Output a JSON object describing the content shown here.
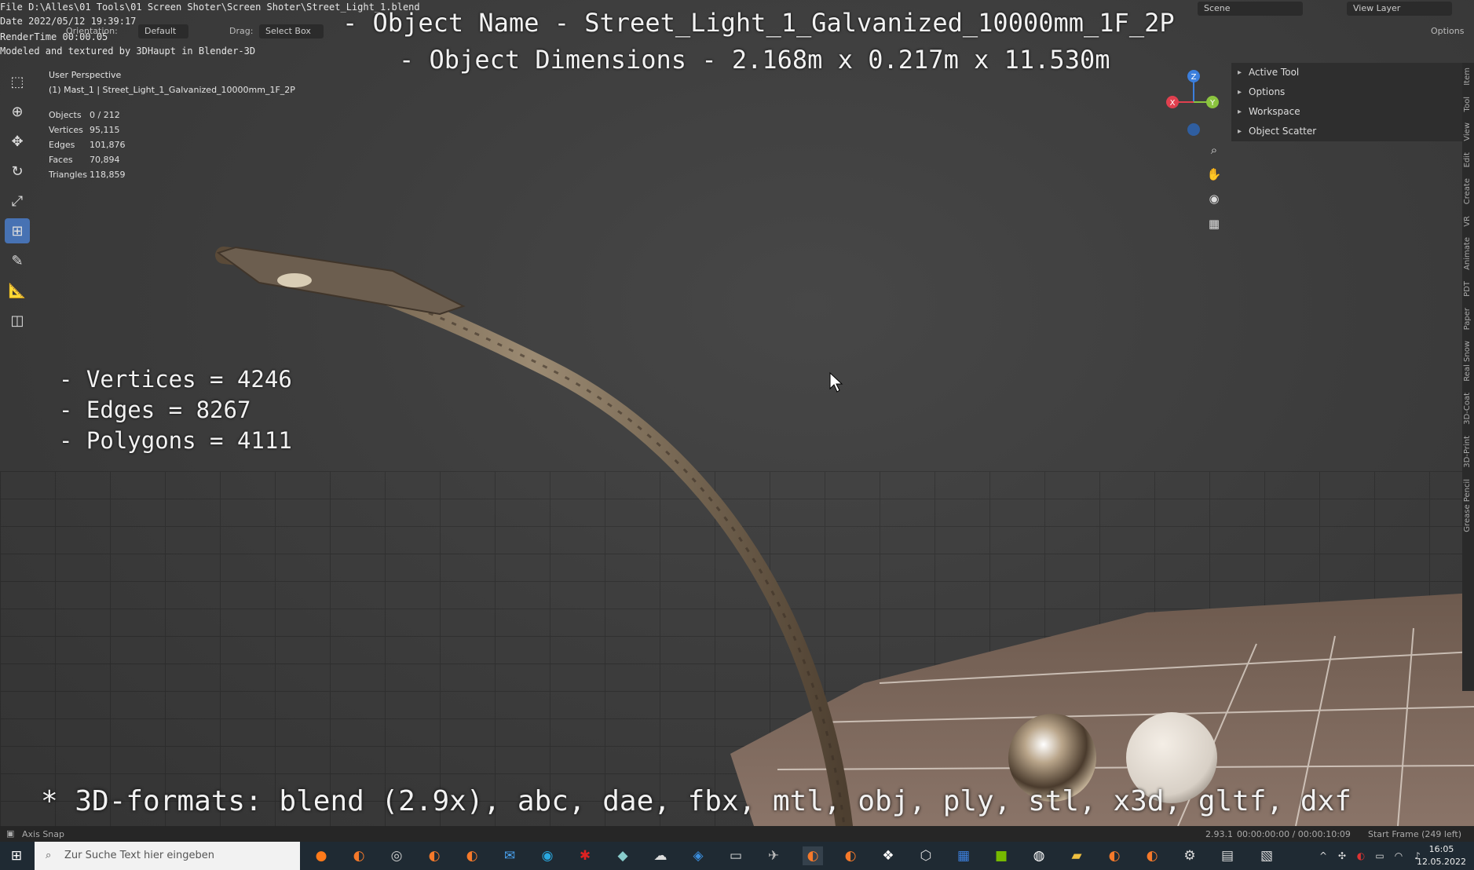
{
  "render_info": {
    "file_line": "File D:\\Alles\\01 Tools\\01 Screen Shoter\\Screen Shoter\\Street_Light_1.blend",
    "date_line": "Date 2022/05/12 19:39:17",
    "rendertime_line": "RenderTime 00:00.05",
    "credit_line": "Modeled and textured by 3DHaupt in Blender-3D"
  },
  "header": {
    "orientation_label": "Orientation:",
    "orientation_value": "Default",
    "drag_label": "Drag:",
    "drag_value": "Select Box",
    "scene": "Scene",
    "view_layer": "View Layer",
    "options": "Options"
  },
  "overlay": {
    "object_name": "- Object Name - Street_Light_1_Galvanized_10000mm_1F_2P",
    "object_dimensions": "- Object Dimensions -  2.168m x 0.217m x 11.530m",
    "vertices": "- Vertices = 4246",
    "edges": "- Edges = 8267",
    "polygons": "- Polygons = 4111",
    "formats": "* 3D-formats: blend (2.9x), abc, dae, fbx, mtl, obj, ply, stl, x3d, gltf, dxf"
  },
  "viewport_info": {
    "perspective": "User Perspective",
    "collection": "(1) Mast_1 | Street_Light_1_Galvanized_10000mm_1F_2P",
    "stats": [
      {
        "label": "Objects",
        "value": "0 / 212"
      },
      {
        "label": "Vertices",
        "value": "95,115"
      },
      {
        "label": "Edges",
        "value": "101,876"
      },
      {
        "label": "Faces",
        "value": "70,894"
      },
      {
        "label": "Triangles",
        "value": "118,859"
      }
    ]
  },
  "side_panel": {
    "items": [
      "Active Tool",
      "Options",
      "Workspace",
      "Object Scatter"
    ]
  },
  "vertical_tabs": [
    "Item",
    "Tool",
    "View",
    "Edit",
    "Create",
    "VR",
    "Animate",
    "PDT",
    "Paper",
    "Real Snow",
    "3D-Coat",
    "3D-Print",
    "Grease Pencil"
  ],
  "gizmo": {
    "x": "X",
    "y": "Y",
    "z": "Z"
  },
  "status_bar": {
    "left": "Axis Snap",
    "version": "2.93.1",
    "timecode": "00:00:00:00 / 00:00:10:09",
    "frame": "Start Frame (249 left)"
  },
  "taskbar": {
    "search_placeholder": "Zur Suche Text hier eingeben",
    "time": "16:05",
    "date": "12.05.2022"
  },
  "colors": {
    "accent": "#4772b3",
    "axis_x": "#e0404f",
    "axis_y": "#8bc43f",
    "axis_z": "#3c7fdc"
  }
}
